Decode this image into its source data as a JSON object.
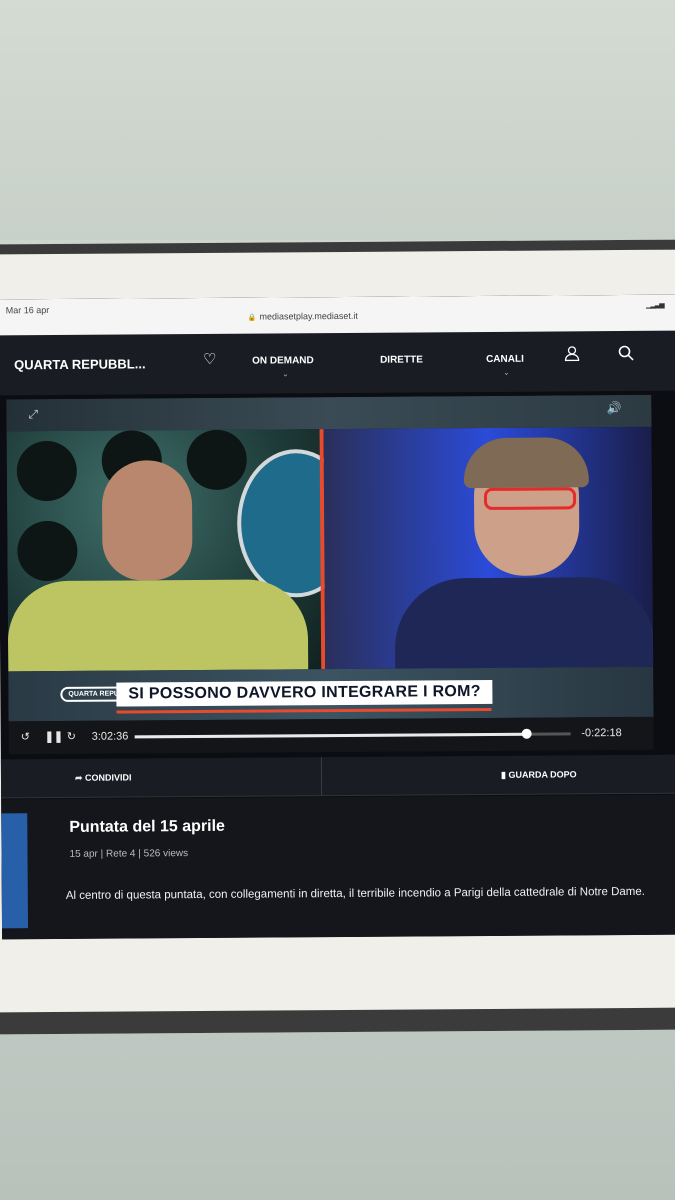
{
  "status_bar": {
    "time": "Mar 16 apr",
    "url": "mediasetplay.mediaset.it"
  },
  "nav": {
    "show_title": "QUARTA REPUBBL...",
    "items": [
      {
        "label": "ON DEMAND",
        "has_dropdown": true
      },
      {
        "label": "DIRETTE",
        "has_dropdown": false
      },
      {
        "label": "CANALI",
        "has_dropdown": true
      }
    ],
    "icons": [
      "heart-icon",
      "user-icon",
      "search-icon"
    ]
  },
  "player": {
    "brand": "QUARTA REPUBBLICA",
    "headline": "SI POSSONO DAVVERO INTEGRARE I ROM?",
    "elapsed": "3:02:36",
    "remaining": "-0:22:18",
    "progress": 0.9,
    "icons": [
      "expand-icon",
      "volume-icon",
      "rewind-15-icon",
      "pause-icon",
      "forward-15-icon"
    ]
  },
  "actions": {
    "share_label": "CONDIVIDI",
    "watch_later_label": "GUARDA DOPO"
  },
  "episode": {
    "title": "Puntata del 15 aprile",
    "meta": "15 apr | Rete 4 | 526 views",
    "description": "Al centro di questa puntata, con collegamenti in diretta, il terribile incendio a Parigi della cattedrale di Notre Dame."
  },
  "colors": {
    "accent": "#e84a2e",
    "nav_bg": "#1a1c24"
  }
}
